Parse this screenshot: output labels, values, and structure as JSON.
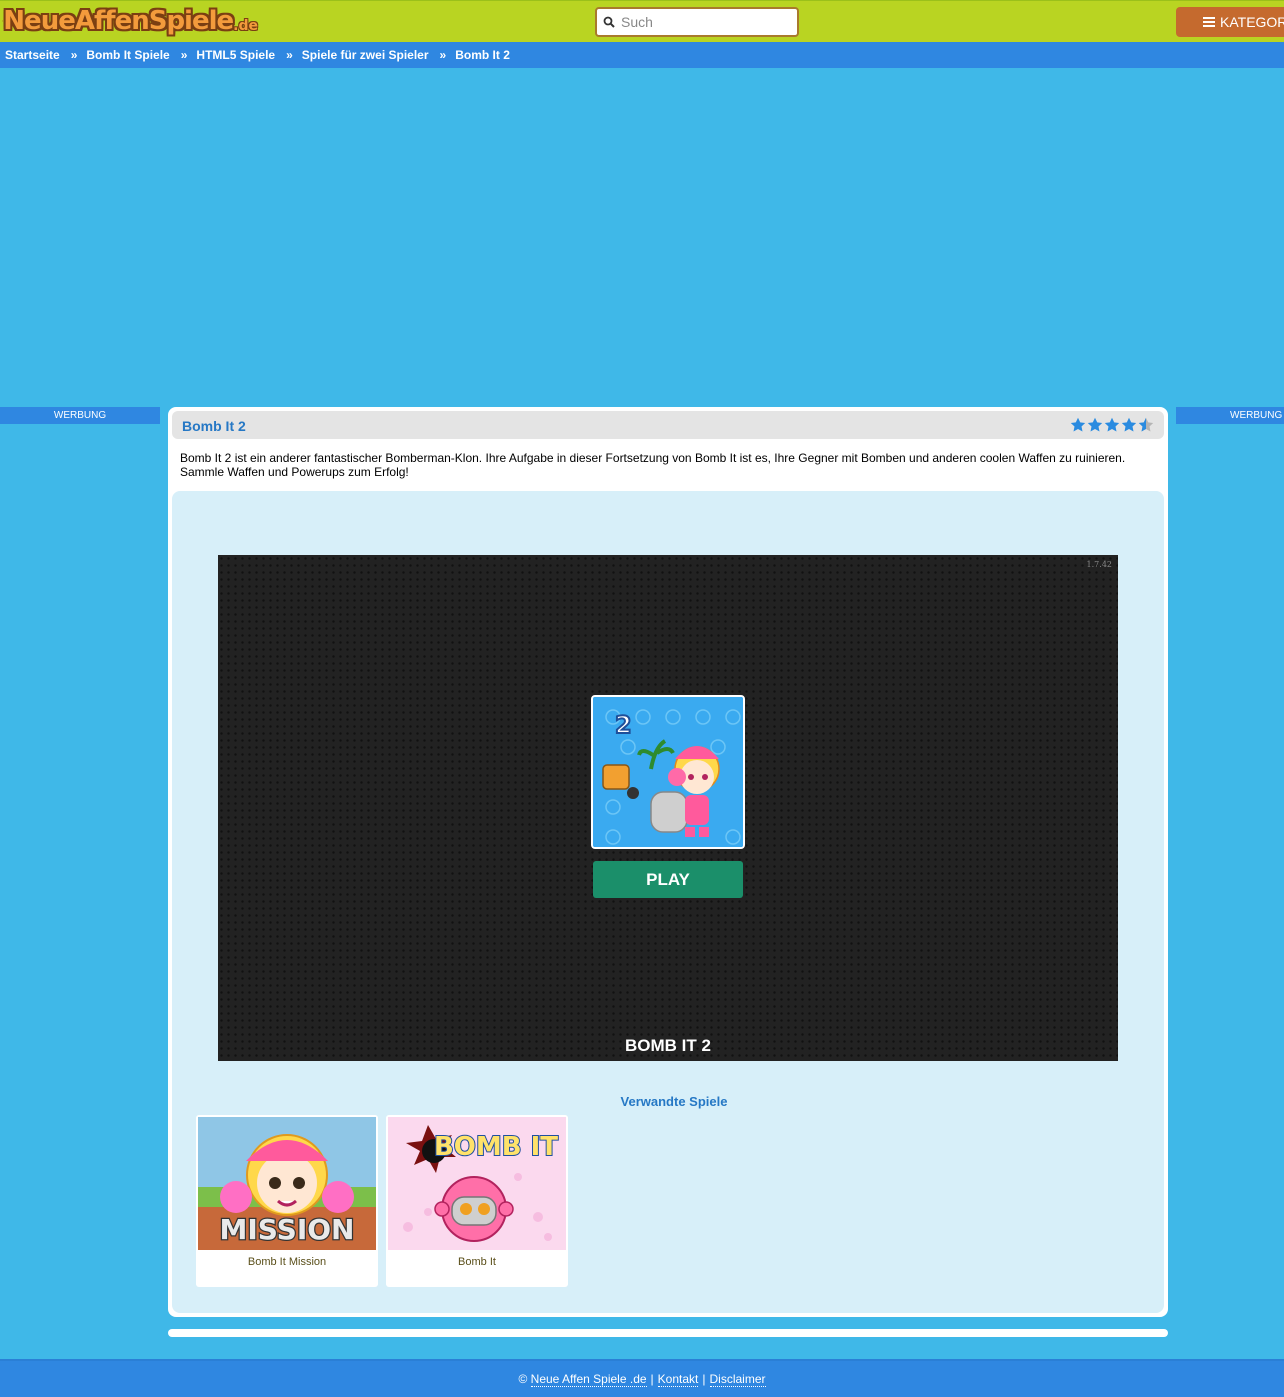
{
  "header": {
    "logo_text": "NeueAffenSpiele",
    "logo_tld": ".de",
    "search_placeholder": "Such",
    "categories_label": "KATEGORIEN"
  },
  "breadcrumb": [
    "Startseite",
    "Bomb It Spiele",
    "HTML5 Spiele",
    "Spiele für zwei Spieler",
    "Bomb It 2"
  ],
  "breadcrumb_separator": "»",
  "ads": {
    "left_label": "WERBUNG",
    "right_label": "WERBUNG"
  },
  "game": {
    "title": "Bomb It 2",
    "rating": 4.5,
    "rating_max": 5,
    "description": "Bomb It 2 ist ein anderer fantastischer Bomberman-Klon. Ihre Aufgabe in dieser Fortsetzung von Bomb It ist es, Ihre Gegner mit Bomben und anderen coolen Waffen zu ruinieren. Sammle Waffen und Powerups zum Erfolg!",
    "version": "1.7.42",
    "play_label": "PLAY",
    "name_caption": "BOMB IT 2",
    "thumb_number": "2"
  },
  "related": {
    "title": "Verwandte Spiele",
    "items": [
      {
        "name": "Bomb It Mission",
        "banner": "MISSION"
      },
      {
        "name": "Bomb It",
        "banner": "BOMB IT"
      }
    ]
  },
  "footer": {
    "copyright": "©",
    "site_link": "Neue Affen Spiele .de",
    "contact": "Kontakt",
    "disclaimer": "Disclaimer",
    "separator": "|"
  },
  "colors": {
    "header_bg": "#b9d422",
    "nav_bg": "#2f87e1",
    "page_bg": "#3fb8e8",
    "accent_title": "#2678c5",
    "play_button": "#1b8f6a",
    "category_button": "#c56a2e",
    "star": "#2a8be0"
  }
}
